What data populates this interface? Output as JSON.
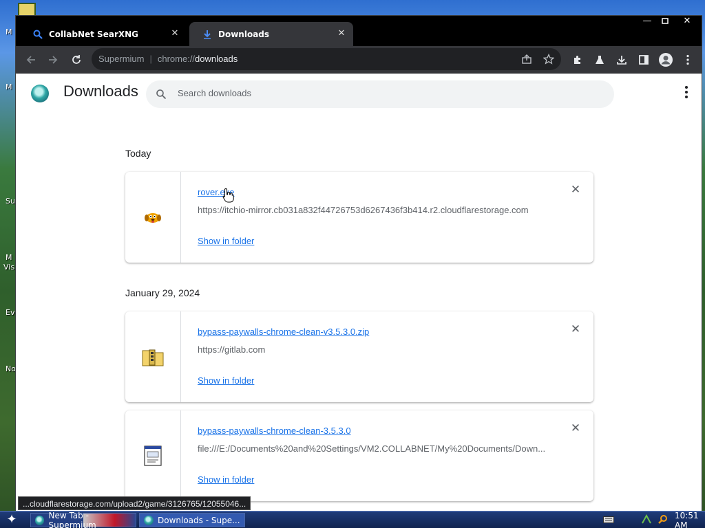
{
  "desktop": {
    "labels": [
      "M",
      "M",
      "Su",
      "M",
      "Vis",
      "Ev",
      "No"
    ]
  },
  "window": {
    "tabs": [
      {
        "label": "CollabNet SearXNG",
        "icon": "search-icon"
      },
      {
        "label": "Downloads",
        "icon": "download-icon"
      }
    ],
    "controls": {
      "minimize": "—",
      "maximize": "▫",
      "close": "✕"
    }
  },
  "toolbar": {
    "omnibox": {
      "site": "Supermium",
      "scheme": "chrome://",
      "host": "downloads"
    }
  },
  "page": {
    "title": "Downloads",
    "search_placeholder": "Search downloads",
    "groups": [
      {
        "date": "Today",
        "items": [
          {
            "file": "rover.exe",
            "source": "https://itchio-mirror.cb031a832f44726753d6267436f3b414.r2.cloudflarestorage.com",
            "action": "Show in folder",
            "icon": "rover-app-icon"
          }
        ]
      },
      {
        "date": "January 29, 2024",
        "items": [
          {
            "file": "bypass-paywalls-chrome-clean-v3.5.3.0.zip",
            "source": "https://gitlab.com",
            "action": "Show in folder",
            "icon": "zip-folder-icon"
          },
          {
            "file": "bypass-paywalls-chrome-clean-3.5.3.0",
            "source": "file:///E:/Documents%20and%20Settings/VM2.COLLABNET/My%20Documents/Down...",
            "action": "Show in folder",
            "icon": "file-icon"
          }
        ]
      }
    ]
  },
  "status_bar": {
    "text": "...cloudflarestorage.com/upload2/game/3126765/12055046..."
  },
  "taskbar": {
    "tasks": [
      {
        "label": "New Tab - Supermium"
      },
      {
        "label": "Downloads - Supe..."
      }
    ],
    "clock": "10:51 AM"
  },
  "colors": {
    "link": "#1a73e8",
    "titlebar": "#000000",
    "toolbar": "#35363a"
  }
}
